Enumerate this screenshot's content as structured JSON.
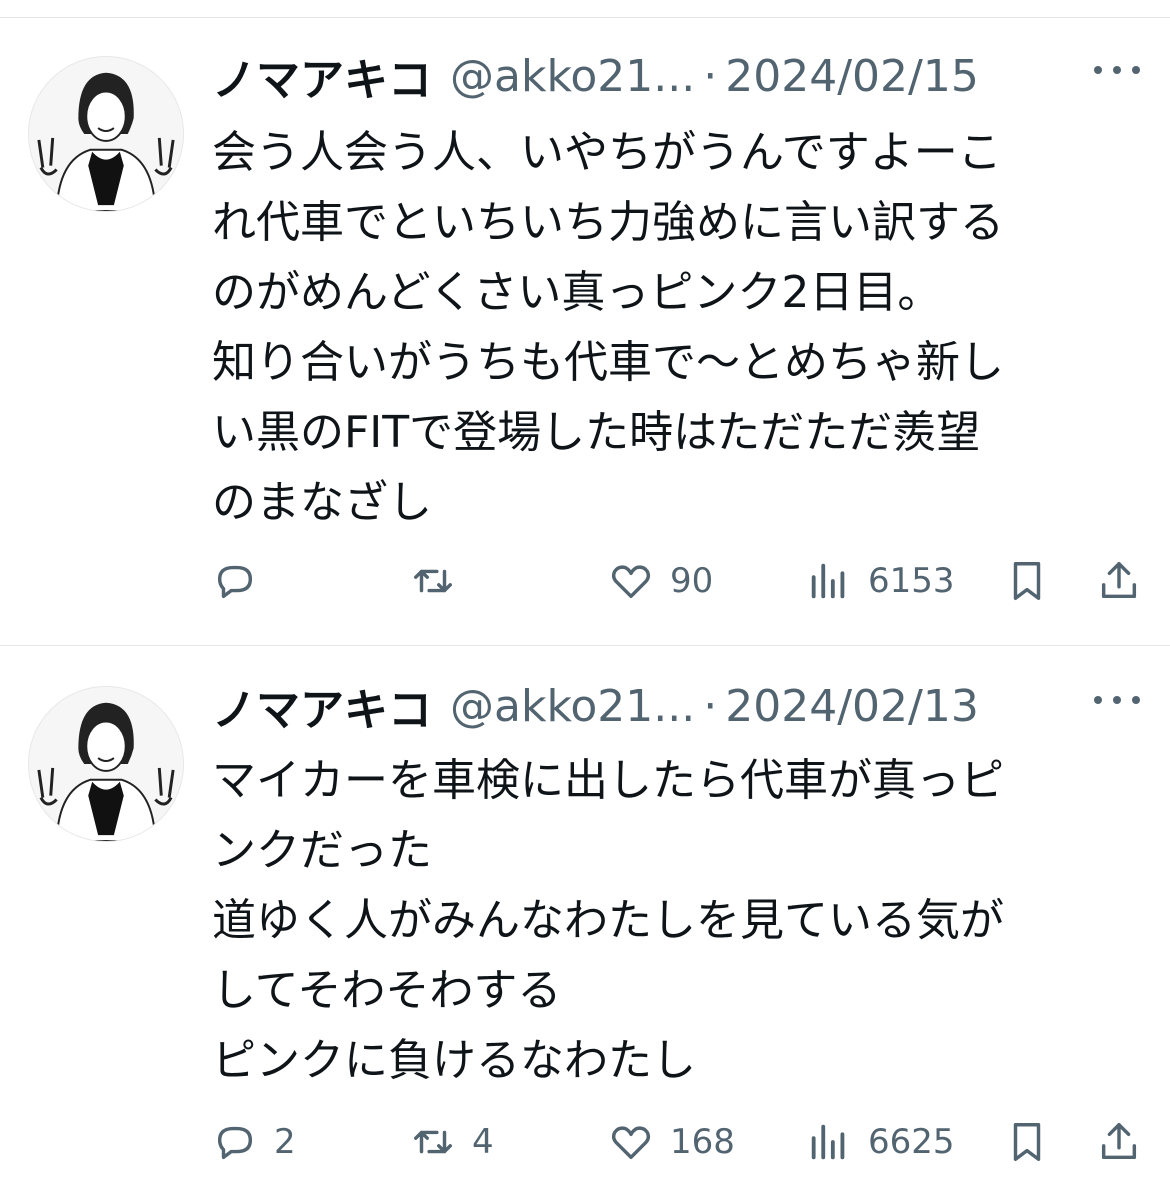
{
  "tweets": [
    {
      "name": "ノマアキコ",
      "handle": "@akko21...",
      "separator": "·",
      "date": "2024/02/15",
      "lines": [
        "会う人会う人、いやちがうんですよーこ",
        "れ代車でといちいち力強めに言い訳する",
        "のがめんどくさい真っピンク2日目。",
        "知り合いがうちも代車で〜とめちゃ新し",
        "い黒のFITで登場した時はただただ羨望",
        "のまなざし"
      ],
      "replies": "",
      "retweets": "",
      "likes": "90",
      "views": "6153"
    },
    {
      "name": "ノマアキコ",
      "handle": "@akko21...",
      "separator": "·",
      "date": "2024/02/13",
      "lines": [
        "マイカーを車検に出したら代車が真っピ",
        "ンクだった",
        "道ゆく人がみんなわたしを見ている気が",
        "してそわそわする",
        "ピンクに負けるなわたし"
      ],
      "replies": "2",
      "retweets": "4",
      "likes": "168",
      "views": "6625"
    }
  ],
  "icons": {
    "more": "more-icon",
    "reply": "reply-icon",
    "retweet": "retweet-icon",
    "like": "heart-icon",
    "views": "views-icon",
    "bookmark": "bookmark-icon",
    "share": "share-icon"
  },
  "colors": {
    "text": "#0f1419",
    "muted": "#536471",
    "divider": "#e3e6e9"
  }
}
